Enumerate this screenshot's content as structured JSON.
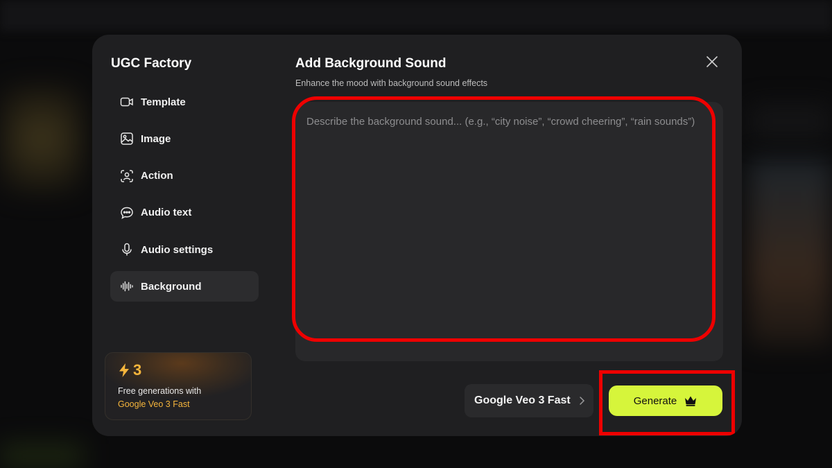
{
  "app": {
    "brand": "UGC Factory"
  },
  "sidebar": {
    "items": [
      {
        "label": "Template",
        "icon": "video-camera-icon",
        "active": false
      },
      {
        "label": "Image",
        "icon": "image-icon",
        "active": false
      },
      {
        "label": "Action",
        "icon": "person-scan-icon",
        "active": false
      },
      {
        "label": "Audio text",
        "icon": "chat-bubble-icon",
        "active": false
      },
      {
        "label": "Audio settings",
        "icon": "microphone-icon",
        "active": false
      },
      {
        "label": "Background",
        "icon": "sound-wave-icon",
        "active": true
      }
    ]
  },
  "promo": {
    "count": "3",
    "text": "Free generations with",
    "model": "Google Veo 3 Fast"
  },
  "main": {
    "title": "Add Background Sound",
    "subtitle": "Enhance the mood with background sound effects",
    "input": {
      "value": "",
      "placeholder": "Describe the background sound... (e.g., “city noise”, “crowd cheering”, “rain sounds”)"
    },
    "model_select": {
      "value": "Google Veo 3 Fast"
    },
    "generate_label": "Generate"
  },
  "colors": {
    "accent": "#d6f53b",
    "promo_highlight": "#f5b53c",
    "annotation": "#ee0000",
    "modal_bg": "#1f1f21"
  }
}
